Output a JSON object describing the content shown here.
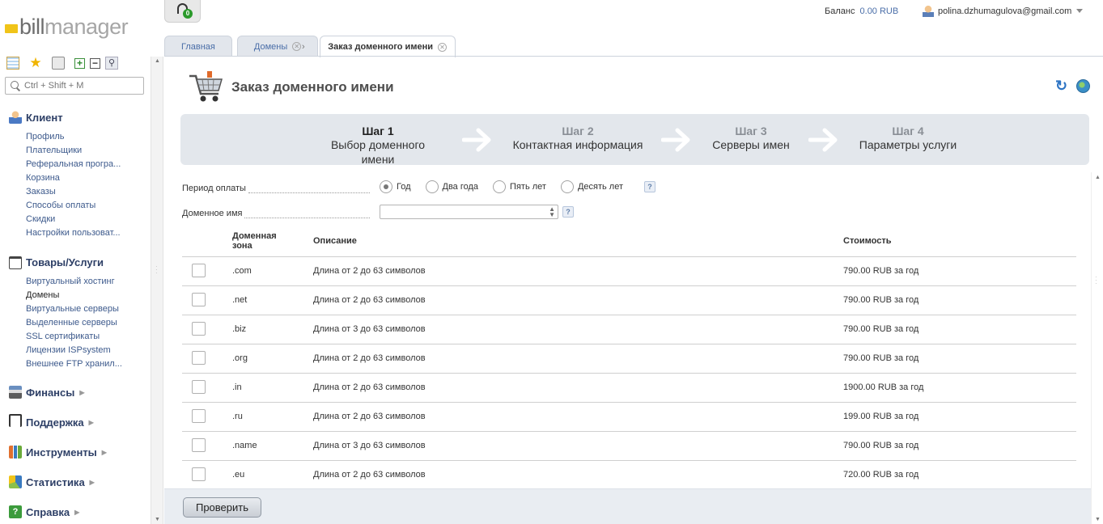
{
  "app": {
    "logo_bill": "bill",
    "logo_manager": "manager",
    "support_badge": "0"
  },
  "header": {
    "balance_label": "Баланс",
    "balance_value": "0.00 RUB",
    "user_email": "polina.dzhumagulova@gmail.com"
  },
  "sidebar": {
    "search_placeholder": "Ctrl + Shift + M",
    "sections": [
      {
        "title": "Клиент",
        "icon": "client-icon",
        "items": [
          "Профиль",
          "Плательщики",
          "Реферальная програ...",
          "Корзина",
          "Заказы",
          "Способы оплаты",
          "Скидки",
          "Настройки пользоват..."
        ]
      },
      {
        "title": "Товары/Услуги",
        "icon": "cart-icon",
        "items": [
          "Виртуальный хостинг",
          "Домены",
          "Виртуальные серверы",
          "Выделенные серверы",
          "SSL сертификаты",
          "Лицензии ISPsystem",
          "Внешнее FTP хранил..."
        ]
      },
      {
        "title": "Финансы",
        "icon": "finance-icon",
        "items": []
      },
      {
        "title": "Поддержка",
        "icon": "headset-icon",
        "items": []
      },
      {
        "title": "Инструменты",
        "icon": "tools-icon",
        "items": []
      },
      {
        "title": "Статистика",
        "icon": "chart-icon",
        "items": []
      },
      {
        "title": "Справка",
        "icon": "help-icon",
        "items": []
      }
    ],
    "active_item": "Домены"
  },
  "tabs": [
    {
      "label": "Главная"
    },
    {
      "label": "Домены"
    },
    {
      "label": "Заказ доменного имени"
    }
  ],
  "page": {
    "title": "Заказ доменного имени"
  },
  "steps": [
    {
      "num": "Шаг 1",
      "label": "Выбор доменного имени",
      "active": true
    },
    {
      "num": "Шаг 2",
      "label": "Контактная информация",
      "active": false
    },
    {
      "num": "Шаг 3",
      "label": "Серверы имен",
      "active": false
    },
    {
      "num": "Шаг 4",
      "label": "Параметры услуги",
      "active": false
    }
  ],
  "form": {
    "period_label": "Период оплаты",
    "period_options": [
      "Год",
      "Два года",
      "Пять лет",
      "Десять лет"
    ],
    "period_selected": "Год",
    "domain_label": "Доменное имя",
    "domain_value": "",
    "help_glyph": "?"
  },
  "table": {
    "col_zone": "Доменная зона",
    "col_zone_l1": "Доменная",
    "col_zone_l2": "зона",
    "col_desc": "Описание",
    "col_price": "Стоимость",
    "rows": [
      {
        "zone": ".com",
        "desc": "Длина от 2 до 63 символов",
        "price": "790.00 RUB за год"
      },
      {
        "zone": ".net",
        "desc": "Длина от 2 до 63 символов",
        "price": "790.00 RUB за год"
      },
      {
        "zone": ".biz",
        "desc": "Длина от 3 до 63 символов",
        "price": "790.00 RUB за год"
      },
      {
        "zone": ".org",
        "desc": "Длина от 2 до 63 символов",
        "price": "790.00 RUB за год"
      },
      {
        "zone": ".in",
        "desc": "Длина от 2 до 63 символов",
        "price": "1900.00 RUB за год"
      },
      {
        "zone": ".ru",
        "desc": "Длина от 2 до 63 символов",
        "price": "199.00 RUB за год"
      },
      {
        "zone": ".name",
        "desc": "Длина от 3 до 63 символов",
        "price": "790.00 RUB за год"
      },
      {
        "zone": ".eu",
        "desc": "Длина от 2 до 63 символов",
        "price": "720.00 RUB за год"
      }
    ]
  },
  "footer": {
    "check_button": "Проверить"
  },
  "colors": {
    "link": "#3d5a8c",
    "steps_bg": "#e3e7ec",
    "logo_accent": "#f0c419"
  }
}
